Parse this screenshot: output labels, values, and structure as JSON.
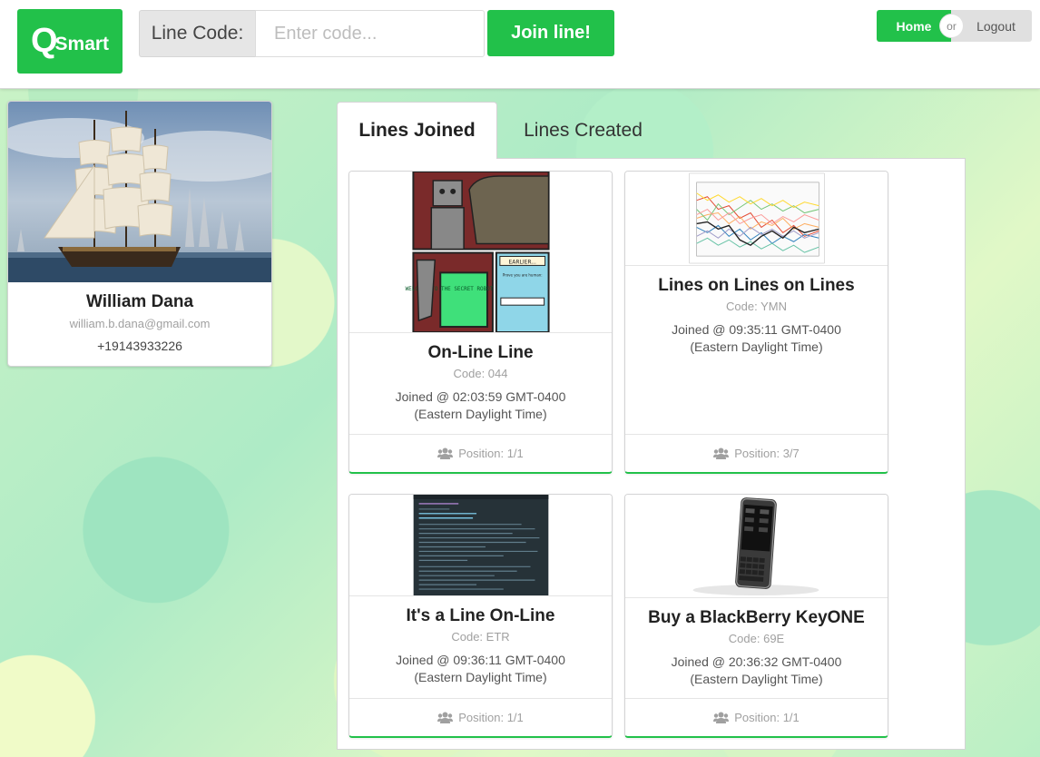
{
  "header": {
    "logo_q": "Q",
    "logo_rest": "Smart",
    "line_code_label": "Line Code:",
    "line_code_placeholder": "Enter code...",
    "line_code_value": "",
    "join_button": "Join line!",
    "home_button": "Home",
    "or_text": "or",
    "logout_button": "Logout"
  },
  "colors": {
    "brand_green": "#22c14a"
  },
  "profile": {
    "name": "William Dana",
    "email": "william.b.dana@gmail.com",
    "phone": "+19143933226",
    "avatar_icon": "sailing-ship-painting"
  },
  "tabs": [
    {
      "label": "Lines Joined",
      "active": true
    },
    {
      "label": "Lines Created",
      "active": false
    }
  ],
  "lines": [
    {
      "title": "On-Line Line",
      "code": "Code: 044",
      "joined": "Joined @ 02:03:59 GMT-0400 (Eastern Daylight Time)",
      "position": "Position: 1/1",
      "image": "robot-comic",
      "comic_label": "EARLIER...",
      "comic_screen_text": "WELCOME TO THE SECRET ROBOT INTERNET",
      "comic_prompt": "Prove you are human:"
    },
    {
      "title": "Lines on Lines on Lines",
      "code": "Code: YMN",
      "joined": "Joined @ 09:35:11 GMT-0400 (Eastern Daylight Time)",
      "position": "Position: 3/7",
      "image": "multi-line-chart"
    },
    {
      "title": "It's a Line On-Line",
      "code": "Code: ETR",
      "joined": "Joined @ 09:36:11 GMT-0400 (Eastern Daylight Time)",
      "position": "Position: 1/1",
      "image": "code-editor"
    },
    {
      "title": "Buy a BlackBerry KeyONE",
      "code": "Code: 69E",
      "joined": "Joined @ 20:36:32 GMT-0400 (Eastern Daylight Time)",
      "position": "Position: 1/1",
      "image": "blackberry-phone"
    }
  ]
}
